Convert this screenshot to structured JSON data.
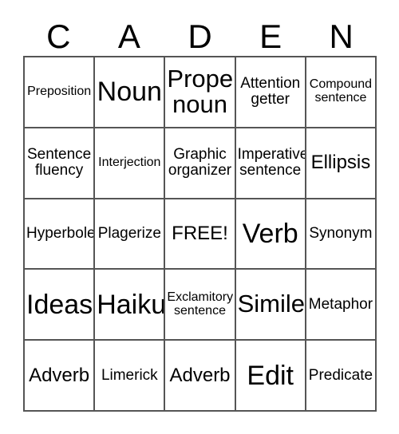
{
  "card": {
    "header_letters": [
      "C",
      "A",
      "D",
      "E",
      "N"
    ],
    "rows": [
      [
        {
          "text": "Preposition",
          "size": "sz-sm"
        },
        {
          "text": "Noun",
          "size": "sz-xxl"
        },
        {
          "text": "Proper noun",
          "size": "sz-xl"
        },
        {
          "text": "Attention getter",
          "size": "sz-md"
        },
        {
          "text": "Compound sentence",
          "size": "sz-sm"
        }
      ],
      [
        {
          "text": "Sentence fluency",
          "size": "sz-md"
        },
        {
          "text": "Interjection",
          "size": "sz-sm"
        },
        {
          "text": "Graphic organizer",
          "size": "sz-md"
        },
        {
          "text": "Imperative sentence",
          "size": "sz-md"
        },
        {
          "text": "Ellipsis",
          "size": "sz-lg"
        }
      ],
      [
        {
          "text": "Hyperbole",
          "size": "sz-md"
        },
        {
          "text": "Plagerize",
          "size": "sz-md"
        },
        {
          "text": "FREE!",
          "size": "sz-lg"
        },
        {
          "text": "Verb",
          "size": "sz-xxl"
        },
        {
          "text": "Synonym",
          "size": "sz-md"
        }
      ],
      [
        {
          "text": "Ideas",
          "size": "sz-xxl"
        },
        {
          "text": "Haiku",
          "size": "sz-xxl"
        },
        {
          "text": "Exclamitory sentence",
          "size": "sz-sm"
        },
        {
          "text": "Simile",
          "size": "sz-xl"
        },
        {
          "text": "Metaphor",
          "size": "sz-md"
        }
      ],
      [
        {
          "text": "Adverb",
          "size": "sz-lg"
        },
        {
          "text": "Limerick",
          "size": "sz-md"
        },
        {
          "text": "Adverb",
          "size": "sz-lg"
        },
        {
          "text": "Edit",
          "size": "sz-xxl"
        },
        {
          "text": "Predicate",
          "size": "sz-md"
        }
      ]
    ]
  },
  "colors": {
    "grid_line": "#555555",
    "text": "#000000",
    "background": "#ffffff"
  }
}
